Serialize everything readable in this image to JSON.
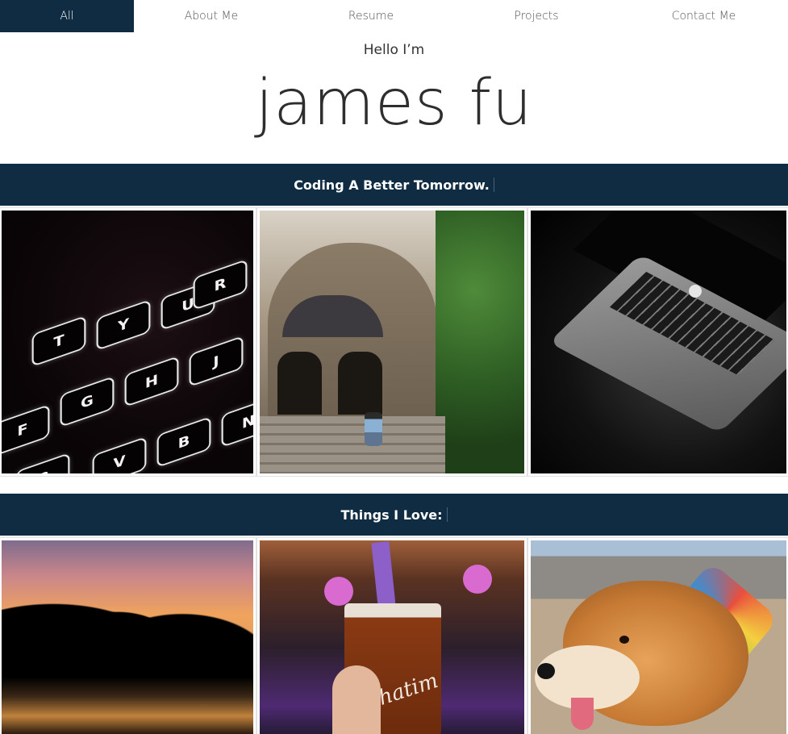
{
  "nav": {
    "items": [
      {
        "label": "All",
        "active": true
      },
      {
        "label": "About Me",
        "active": false
      },
      {
        "label": "Resume",
        "active": false
      },
      {
        "label": "Projects",
        "active": false
      },
      {
        "label": "Contact Me",
        "active": false
      }
    ]
  },
  "hero": {
    "greeting": "Hello I’m",
    "name": "james fu"
  },
  "sections": [
    {
      "title": "Coding A Better Tomorrow.",
      "photos": [
        "keyboard-photo",
        "university-building-photo",
        "laptop-photo"
      ]
    },
    {
      "title": "Things I Love:",
      "photos": [
        "sunset-lake-photo",
        "bubble-tea-photo",
        "corgi-beach-photo"
      ]
    }
  ],
  "photo_text": {
    "keys": [
      "T",
      "Y",
      "U",
      "G",
      "H",
      "J",
      "N",
      "B",
      "V",
      "C",
      "F",
      "R"
    ],
    "cup_brand": "Chatim"
  },
  "colors": {
    "primary_navy": "#0f2c42",
    "nav_text": "#555555",
    "name_text": "#2e2e2e"
  }
}
